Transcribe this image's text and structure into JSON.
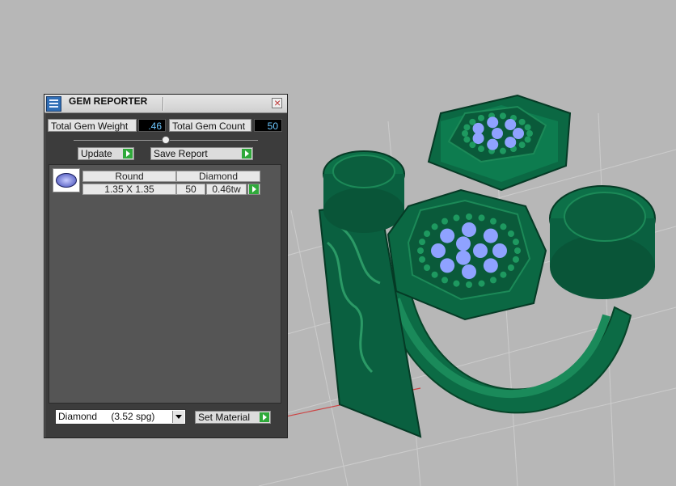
{
  "window": {
    "title": "GEM REPORTER",
    "close_glyph": "×"
  },
  "totals": {
    "weight_label": "Total Gem Weight",
    "weight_value": ".46",
    "count_label": "Total Gem Count",
    "count_value": "50"
  },
  "toolbar": {
    "update_label": "Update",
    "save_report_label": "Save Report"
  },
  "gems": [
    {
      "icon": "oval-gem-icon",
      "shape": "Round",
      "material": "Diamond",
      "size": "1.35 X 1.35",
      "count": "50",
      "weight": "0.46tw"
    }
  ],
  "material_select": {
    "name": "Diamond",
    "sg": "(3.52 spg)"
  },
  "set_material_label": "Set Material",
  "colors": {
    "ring_green": "#0e6a43",
    "stone_blue": "#8fa2ff",
    "accent_green": "#2fa93a",
    "value_text": "#6cc7ff"
  }
}
